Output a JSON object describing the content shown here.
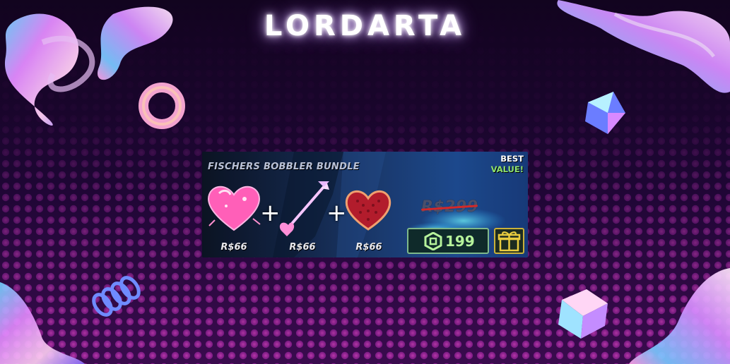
{
  "brand": {
    "name": "LORDARTA"
  },
  "bundle": {
    "title": "FISCHERS BOBBLER BUNDLE",
    "badge": {
      "line1": "BEST",
      "line2": "VALUE!"
    },
    "items": [
      {
        "icon": "pink-heart-icon",
        "price": "R$66"
      },
      {
        "icon": "cupid-arrow-icon",
        "price": "R$66"
      },
      {
        "icon": "red-heart-icon",
        "price": "R$66"
      }
    ],
    "plus_sign": "+",
    "original_price": "R$299",
    "sale_price": "199",
    "currency_icon": "robux-icon",
    "gift_icon": "gift-icon"
  },
  "colors": {
    "background": "#16052a",
    "accent": "#b57cff",
    "price_green": "#b6f29b",
    "value_green": "#8fe36b",
    "strike_red": "#d42828",
    "gift_gold": "#c9b13a"
  }
}
